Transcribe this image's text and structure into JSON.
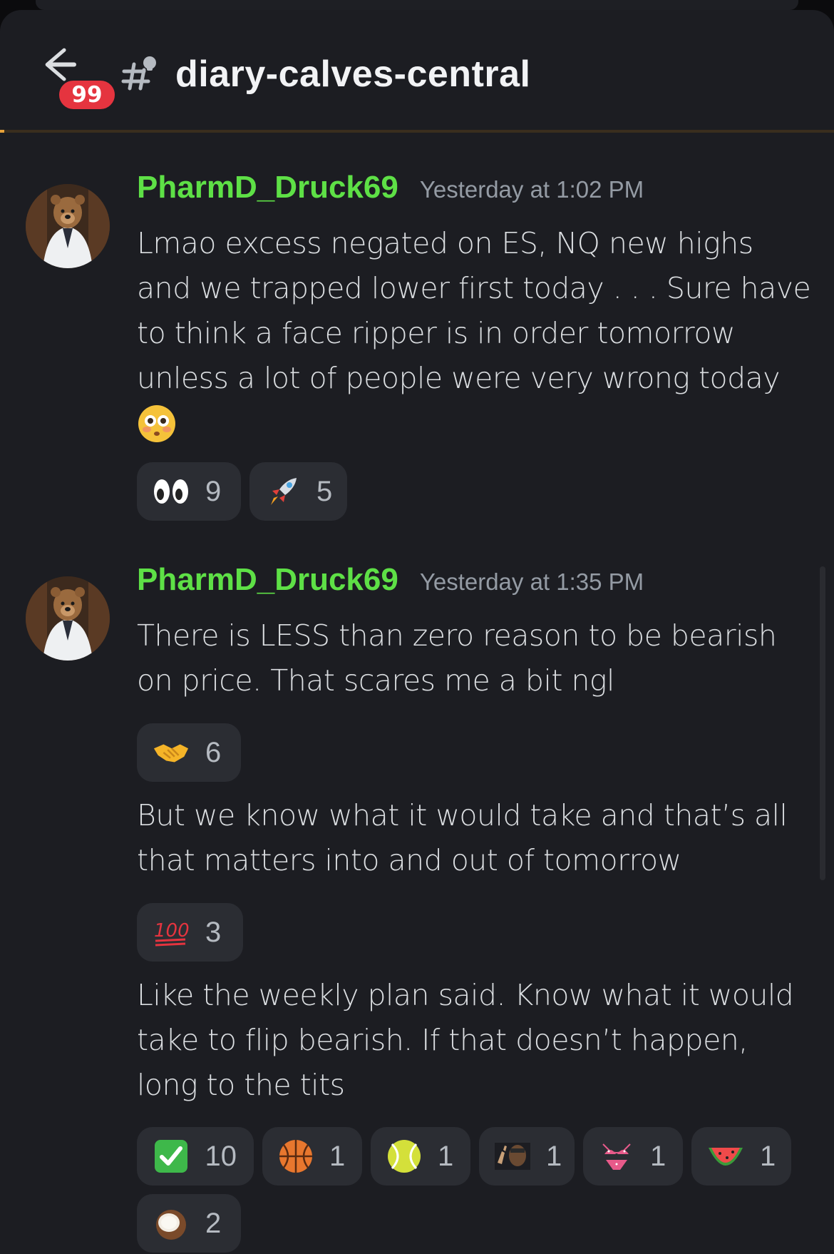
{
  "header": {
    "back_label": "Back",
    "unread_badge": "99",
    "channel_name": "diary-calves-central"
  },
  "messages": [
    {
      "author": "PharmD_Druck69",
      "timestamp": "Yesterday at 1:02 PM",
      "lines": [
        "Lmao excess negated on ES, NQ new highs",
        "and we trapped lower first today . . . Sure have",
        "to think a face ripper is in order tomorrow",
        "unless a lot of people were very wrong today"
      ],
      "inline_emoji": "flushed-face",
      "reactions": [
        {
          "emoji": "eyes",
          "count": "9"
        },
        {
          "emoji": "rocket",
          "count": "5"
        }
      ]
    },
    {
      "author": "PharmD_Druck69",
      "timestamp": "Yesterday at 1:35 PM",
      "blocks": [
        {
          "lines": [
            "There is LESS than zero reason to be bearish",
            "on price. That scares me a bit ngl"
          ],
          "reactions": [
            {
              "emoji": "handshake",
              "count": "6"
            }
          ]
        },
        {
          "lines": [
            "But we know what it would take and that’s all",
            "that matters into and out of tomorrow"
          ],
          "reactions": [
            {
              "emoji": "hundred",
              "count": "3"
            }
          ]
        },
        {
          "lines": [
            "Like the weekly plan said. Know what it would",
            "take to flip bearish. If that doesn’t happen,",
            "long to the tits"
          ],
          "reactions": [
            {
              "emoji": "check-mark",
              "count": "10"
            },
            {
              "emoji": "basketball",
              "count": "1"
            },
            {
              "emoji": "tennis-ball",
              "count": "1"
            },
            {
              "emoji": "custom-face",
              "count": "1"
            },
            {
              "emoji": "bikini",
              "count": "1"
            },
            {
              "emoji": "watermelon",
              "count": "1"
            },
            {
              "emoji": "coconut",
              "count": "2"
            }
          ]
        }
      ]
    }
  ]
}
